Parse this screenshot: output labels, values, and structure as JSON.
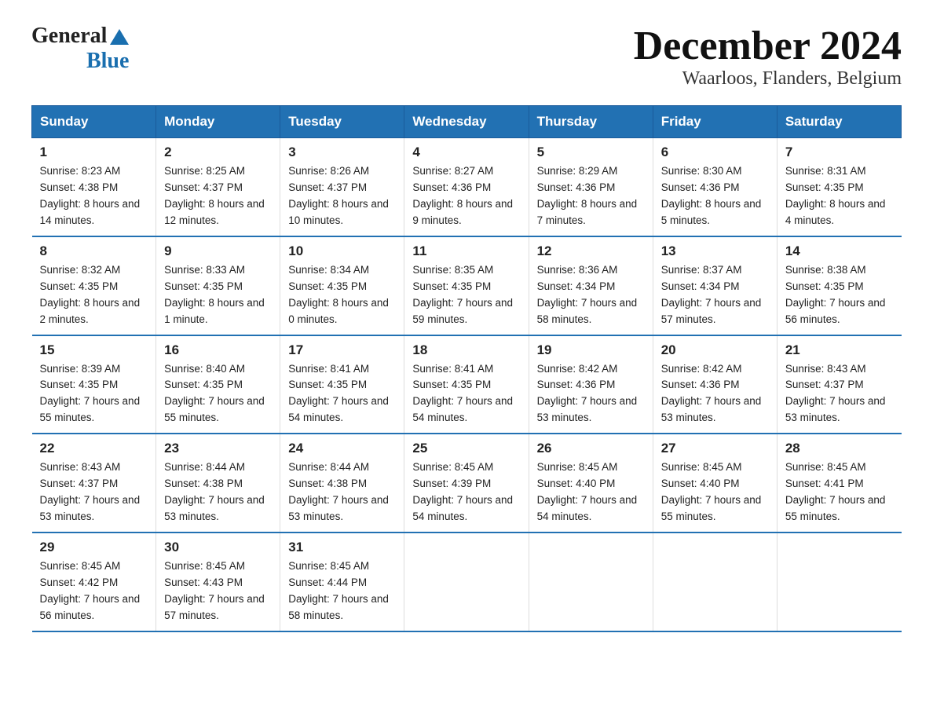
{
  "header": {
    "logo_text_general": "General",
    "logo_text_blue": "Blue",
    "title": "December 2024",
    "subtitle": "Waarloos, Flanders, Belgium"
  },
  "days_of_week": [
    "Sunday",
    "Monday",
    "Tuesday",
    "Wednesday",
    "Thursday",
    "Friday",
    "Saturday"
  ],
  "weeks": [
    [
      {
        "day": "1",
        "sunrise": "8:23 AM",
        "sunset": "4:38 PM",
        "daylight": "8 hours and 14 minutes."
      },
      {
        "day": "2",
        "sunrise": "8:25 AM",
        "sunset": "4:37 PM",
        "daylight": "8 hours and 12 minutes."
      },
      {
        "day": "3",
        "sunrise": "8:26 AM",
        "sunset": "4:37 PM",
        "daylight": "8 hours and 10 minutes."
      },
      {
        "day": "4",
        "sunrise": "8:27 AM",
        "sunset": "4:36 PM",
        "daylight": "8 hours and 9 minutes."
      },
      {
        "day": "5",
        "sunrise": "8:29 AM",
        "sunset": "4:36 PM",
        "daylight": "8 hours and 7 minutes."
      },
      {
        "day": "6",
        "sunrise": "8:30 AM",
        "sunset": "4:36 PM",
        "daylight": "8 hours and 5 minutes."
      },
      {
        "day": "7",
        "sunrise": "8:31 AM",
        "sunset": "4:35 PM",
        "daylight": "8 hours and 4 minutes."
      }
    ],
    [
      {
        "day": "8",
        "sunrise": "8:32 AM",
        "sunset": "4:35 PM",
        "daylight": "8 hours and 2 minutes."
      },
      {
        "day": "9",
        "sunrise": "8:33 AM",
        "sunset": "4:35 PM",
        "daylight": "8 hours and 1 minute."
      },
      {
        "day": "10",
        "sunrise": "8:34 AM",
        "sunset": "4:35 PM",
        "daylight": "8 hours and 0 minutes."
      },
      {
        "day": "11",
        "sunrise": "8:35 AM",
        "sunset": "4:35 PM",
        "daylight": "7 hours and 59 minutes."
      },
      {
        "day": "12",
        "sunrise": "8:36 AM",
        "sunset": "4:34 PM",
        "daylight": "7 hours and 58 minutes."
      },
      {
        "day": "13",
        "sunrise": "8:37 AM",
        "sunset": "4:34 PM",
        "daylight": "7 hours and 57 minutes."
      },
      {
        "day": "14",
        "sunrise": "8:38 AM",
        "sunset": "4:35 PM",
        "daylight": "7 hours and 56 minutes."
      }
    ],
    [
      {
        "day": "15",
        "sunrise": "8:39 AM",
        "sunset": "4:35 PM",
        "daylight": "7 hours and 55 minutes."
      },
      {
        "day": "16",
        "sunrise": "8:40 AM",
        "sunset": "4:35 PM",
        "daylight": "7 hours and 55 minutes."
      },
      {
        "day": "17",
        "sunrise": "8:41 AM",
        "sunset": "4:35 PM",
        "daylight": "7 hours and 54 minutes."
      },
      {
        "day": "18",
        "sunrise": "8:41 AM",
        "sunset": "4:35 PM",
        "daylight": "7 hours and 54 minutes."
      },
      {
        "day": "19",
        "sunrise": "8:42 AM",
        "sunset": "4:36 PM",
        "daylight": "7 hours and 53 minutes."
      },
      {
        "day": "20",
        "sunrise": "8:42 AM",
        "sunset": "4:36 PM",
        "daylight": "7 hours and 53 minutes."
      },
      {
        "day": "21",
        "sunrise": "8:43 AM",
        "sunset": "4:37 PM",
        "daylight": "7 hours and 53 minutes."
      }
    ],
    [
      {
        "day": "22",
        "sunrise": "8:43 AM",
        "sunset": "4:37 PM",
        "daylight": "7 hours and 53 minutes."
      },
      {
        "day": "23",
        "sunrise": "8:44 AM",
        "sunset": "4:38 PM",
        "daylight": "7 hours and 53 minutes."
      },
      {
        "day": "24",
        "sunrise": "8:44 AM",
        "sunset": "4:38 PM",
        "daylight": "7 hours and 53 minutes."
      },
      {
        "day": "25",
        "sunrise": "8:45 AM",
        "sunset": "4:39 PM",
        "daylight": "7 hours and 54 minutes."
      },
      {
        "day": "26",
        "sunrise": "8:45 AM",
        "sunset": "4:40 PM",
        "daylight": "7 hours and 54 minutes."
      },
      {
        "day": "27",
        "sunrise": "8:45 AM",
        "sunset": "4:40 PM",
        "daylight": "7 hours and 55 minutes."
      },
      {
        "day": "28",
        "sunrise": "8:45 AM",
        "sunset": "4:41 PM",
        "daylight": "7 hours and 55 minutes."
      }
    ],
    [
      {
        "day": "29",
        "sunrise": "8:45 AM",
        "sunset": "4:42 PM",
        "daylight": "7 hours and 56 minutes."
      },
      {
        "day": "30",
        "sunrise": "8:45 AM",
        "sunset": "4:43 PM",
        "daylight": "7 hours and 57 minutes."
      },
      {
        "day": "31",
        "sunrise": "8:45 AM",
        "sunset": "4:44 PM",
        "daylight": "7 hours and 58 minutes."
      },
      null,
      null,
      null,
      null
    ]
  ],
  "labels": {
    "sunrise": "Sunrise:",
    "sunset": "Sunset:",
    "daylight": "Daylight:"
  }
}
